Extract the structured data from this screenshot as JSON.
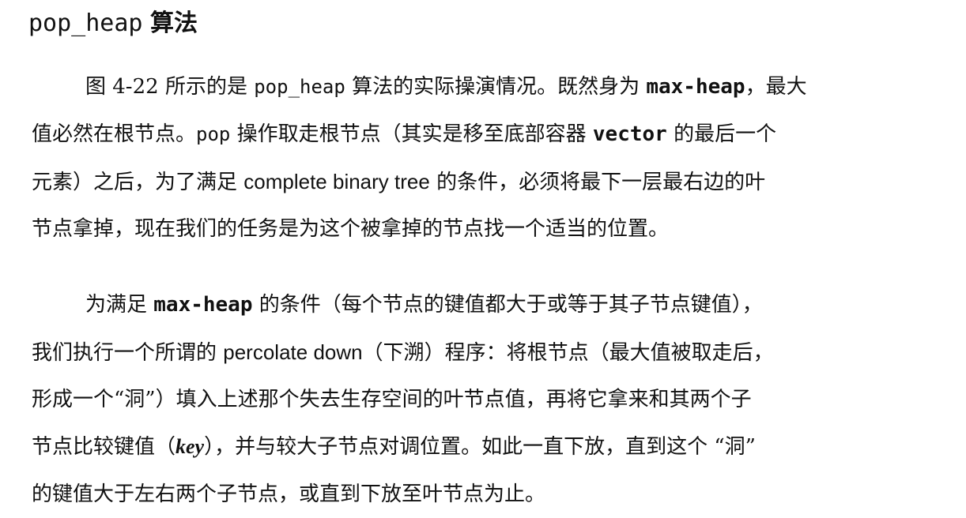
{
  "heading": {
    "code": "pop_heap",
    "label": "算法"
  },
  "paragraph1": {
    "l1": {
      "a": "图 4-22 所示的是 ",
      "code": "pop_heap",
      "b": " 算法的实际操演情况。既然身为 ",
      "code2": "max-heap",
      "c": "，最大"
    },
    "l2": {
      "a": "值必然在根节点。",
      "code": "pop",
      "b": " 操作取走根节点（其实是移至底部容器 ",
      "code2": "vector",
      "c": " 的最后一个"
    },
    "l3": {
      "a": "元素）之后，为了满足 ",
      "term": "complete binary tree",
      "b": " 的条件，必须将最下一层最右边的叶"
    },
    "l4": {
      "a": "节点拿掉，现在我们的任务是为这个被拿掉的节点找一个适当的位置。"
    }
  },
  "paragraph2": {
    "l1": {
      "a": "为满足 ",
      "code": "max-heap",
      "b": " 的条件（每个节点的键值都大于或等于其子节点键值），"
    },
    "l2": {
      "a": "我们执行一个所谓的 ",
      "term": "percolate down",
      "b": "（下溯）程序：将根节点（最大值被取走后，"
    },
    "l3": {
      "a": "形成一个“洞”）填入上述那个失去生存空间的叶节点值，再将它拿来和其两个子"
    },
    "l4": {
      "a": "节点比较键值（",
      "term": "key",
      "b": "），并与较大子节点对调位置。如此一直下放，直到这个 “洞”"
    },
    "l5": {
      "a": "的键值大于左右两个子节点，或直到下放至叶节点为止。"
    }
  }
}
